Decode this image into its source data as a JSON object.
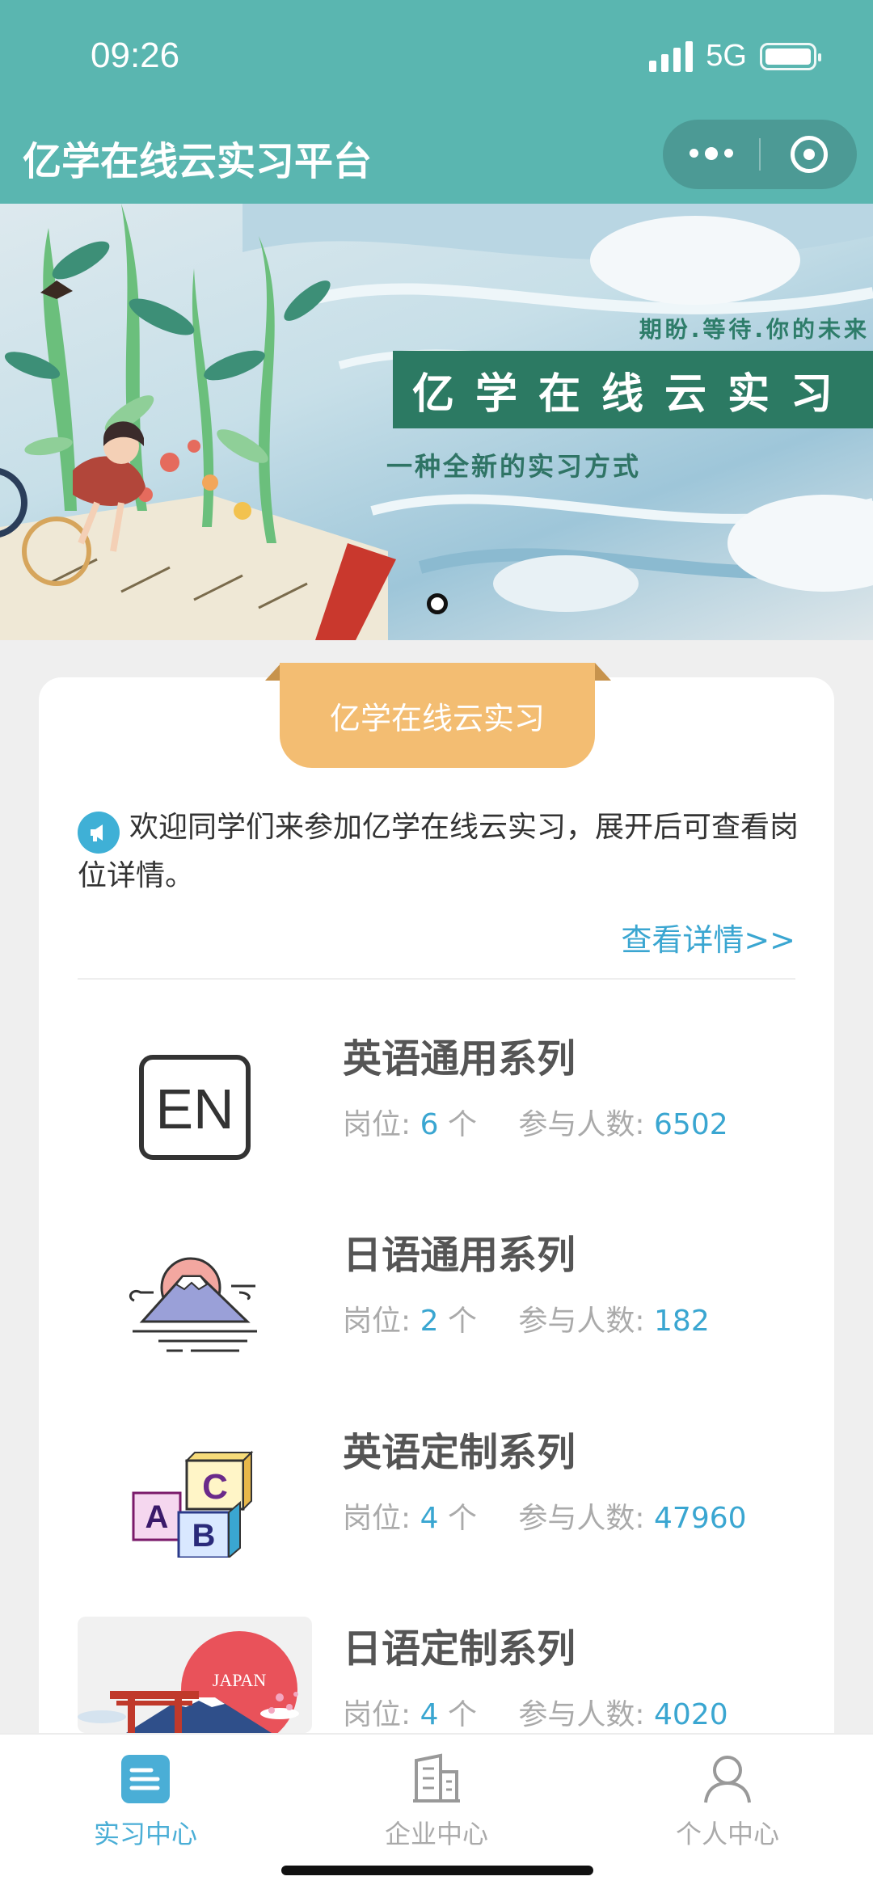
{
  "status_bar": {
    "time": "09:26",
    "network": "5G",
    "battery_level": 1.0
  },
  "header": {
    "title": "亿学在线云实习平台",
    "menu_icon": "more-dots-icon",
    "close_icon": "target-circle-icon"
  },
  "banner": {
    "tagline": "期盼.等待.你的未来",
    "headline": "亿学在线云实习",
    "subtitle": "一种全新的实习方式",
    "slide_count": 1,
    "active_slide": 1
  },
  "card": {
    "ribbon": "亿学在线云实习",
    "notice": "欢迎同学们来参加亿学在线云实习，展开后可查看岗位详情。",
    "detail_link": "查看详情>>",
    "series": [
      {
        "name": "英语通用系列",
        "positions_label": "岗位:",
        "positions": "6",
        "unit": "个",
        "participants_label": "参与人数:",
        "participants": "6502",
        "icon": "en-logo-icon"
      },
      {
        "name": "日语通用系列",
        "positions_label": "岗位:",
        "positions": "2",
        "unit": "个",
        "participants_label": "参与人数:",
        "participants": "182",
        "icon": "mount-fuji-icon"
      },
      {
        "name": "英语定制系列",
        "positions_label": "岗位:",
        "positions": "4",
        "unit": "个",
        "participants_label": "参与人数:",
        "participants": "47960",
        "icon": "abc-blocks-icon"
      },
      {
        "name": "日语定制系列",
        "positions_label": "岗位:",
        "positions": "4",
        "unit": "个",
        "participants_label": "参与人数:",
        "participants": "4020",
        "icon": "japan-torii-image",
        "image_text": "JAPAN"
      }
    ]
  },
  "tabbar": {
    "tabs": [
      {
        "label": "实习中心",
        "icon": "list-doc-icon",
        "active": true
      },
      {
        "label": "企业中心",
        "icon": "building-icon",
        "active": false
      },
      {
        "label": "个人中心",
        "icon": "person-icon",
        "active": false
      }
    ]
  },
  "colors": {
    "primary": "#5ab6b0",
    "accent": "#3aa6d1",
    "ribbon": "#f3bd72",
    "banner_green": "#2c7a63"
  }
}
